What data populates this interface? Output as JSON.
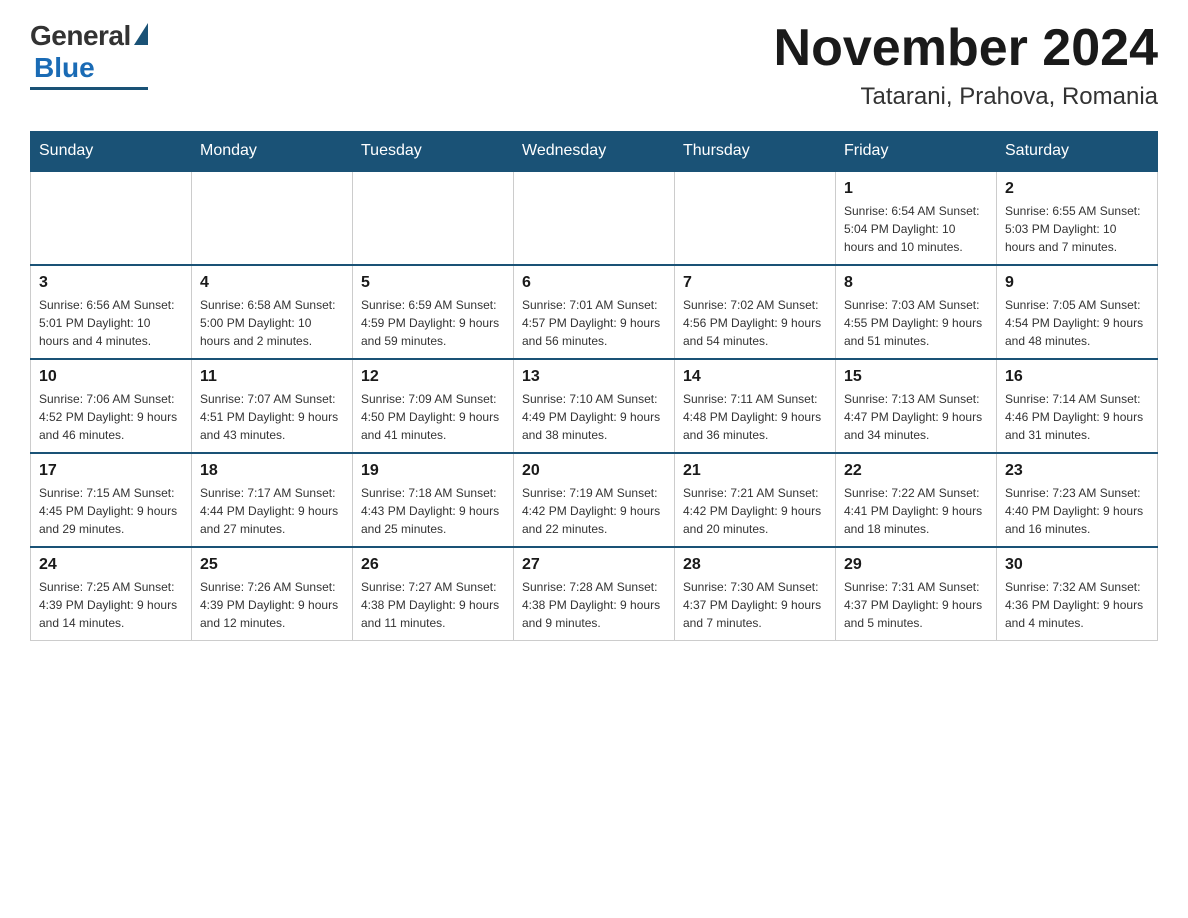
{
  "header": {
    "logo_general": "General",
    "logo_blue": "Blue",
    "month_title": "November 2024",
    "location": "Tatarani, Prahova, Romania"
  },
  "days_of_week": [
    "Sunday",
    "Monday",
    "Tuesday",
    "Wednesday",
    "Thursday",
    "Friday",
    "Saturday"
  ],
  "weeks": [
    [
      {
        "day": "",
        "info": ""
      },
      {
        "day": "",
        "info": ""
      },
      {
        "day": "",
        "info": ""
      },
      {
        "day": "",
        "info": ""
      },
      {
        "day": "",
        "info": ""
      },
      {
        "day": "1",
        "info": "Sunrise: 6:54 AM\nSunset: 5:04 PM\nDaylight: 10 hours\nand 10 minutes."
      },
      {
        "day": "2",
        "info": "Sunrise: 6:55 AM\nSunset: 5:03 PM\nDaylight: 10 hours\nand 7 minutes."
      }
    ],
    [
      {
        "day": "3",
        "info": "Sunrise: 6:56 AM\nSunset: 5:01 PM\nDaylight: 10 hours\nand 4 minutes."
      },
      {
        "day": "4",
        "info": "Sunrise: 6:58 AM\nSunset: 5:00 PM\nDaylight: 10 hours\nand 2 minutes."
      },
      {
        "day": "5",
        "info": "Sunrise: 6:59 AM\nSunset: 4:59 PM\nDaylight: 9 hours\nand 59 minutes."
      },
      {
        "day": "6",
        "info": "Sunrise: 7:01 AM\nSunset: 4:57 PM\nDaylight: 9 hours\nand 56 minutes."
      },
      {
        "day": "7",
        "info": "Sunrise: 7:02 AM\nSunset: 4:56 PM\nDaylight: 9 hours\nand 54 minutes."
      },
      {
        "day": "8",
        "info": "Sunrise: 7:03 AM\nSunset: 4:55 PM\nDaylight: 9 hours\nand 51 minutes."
      },
      {
        "day": "9",
        "info": "Sunrise: 7:05 AM\nSunset: 4:54 PM\nDaylight: 9 hours\nand 48 minutes."
      }
    ],
    [
      {
        "day": "10",
        "info": "Sunrise: 7:06 AM\nSunset: 4:52 PM\nDaylight: 9 hours\nand 46 minutes."
      },
      {
        "day": "11",
        "info": "Sunrise: 7:07 AM\nSunset: 4:51 PM\nDaylight: 9 hours\nand 43 minutes."
      },
      {
        "day": "12",
        "info": "Sunrise: 7:09 AM\nSunset: 4:50 PM\nDaylight: 9 hours\nand 41 minutes."
      },
      {
        "day": "13",
        "info": "Sunrise: 7:10 AM\nSunset: 4:49 PM\nDaylight: 9 hours\nand 38 minutes."
      },
      {
        "day": "14",
        "info": "Sunrise: 7:11 AM\nSunset: 4:48 PM\nDaylight: 9 hours\nand 36 minutes."
      },
      {
        "day": "15",
        "info": "Sunrise: 7:13 AM\nSunset: 4:47 PM\nDaylight: 9 hours\nand 34 minutes."
      },
      {
        "day": "16",
        "info": "Sunrise: 7:14 AM\nSunset: 4:46 PM\nDaylight: 9 hours\nand 31 minutes."
      }
    ],
    [
      {
        "day": "17",
        "info": "Sunrise: 7:15 AM\nSunset: 4:45 PM\nDaylight: 9 hours\nand 29 minutes."
      },
      {
        "day": "18",
        "info": "Sunrise: 7:17 AM\nSunset: 4:44 PM\nDaylight: 9 hours\nand 27 minutes."
      },
      {
        "day": "19",
        "info": "Sunrise: 7:18 AM\nSunset: 4:43 PM\nDaylight: 9 hours\nand 25 minutes."
      },
      {
        "day": "20",
        "info": "Sunrise: 7:19 AM\nSunset: 4:42 PM\nDaylight: 9 hours\nand 22 minutes."
      },
      {
        "day": "21",
        "info": "Sunrise: 7:21 AM\nSunset: 4:42 PM\nDaylight: 9 hours\nand 20 minutes."
      },
      {
        "day": "22",
        "info": "Sunrise: 7:22 AM\nSunset: 4:41 PM\nDaylight: 9 hours\nand 18 minutes."
      },
      {
        "day": "23",
        "info": "Sunrise: 7:23 AM\nSunset: 4:40 PM\nDaylight: 9 hours\nand 16 minutes."
      }
    ],
    [
      {
        "day": "24",
        "info": "Sunrise: 7:25 AM\nSunset: 4:39 PM\nDaylight: 9 hours\nand 14 minutes."
      },
      {
        "day": "25",
        "info": "Sunrise: 7:26 AM\nSunset: 4:39 PM\nDaylight: 9 hours\nand 12 minutes."
      },
      {
        "day": "26",
        "info": "Sunrise: 7:27 AM\nSunset: 4:38 PM\nDaylight: 9 hours\nand 11 minutes."
      },
      {
        "day": "27",
        "info": "Sunrise: 7:28 AM\nSunset: 4:38 PM\nDaylight: 9 hours\nand 9 minutes."
      },
      {
        "day": "28",
        "info": "Sunrise: 7:30 AM\nSunset: 4:37 PM\nDaylight: 9 hours\nand 7 minutes."
      },
      {
        "day": "29",
        "info": "Sunrise: 7:31 AM\nSunset: 4:37 PM\nDaylight: 9 hours\nand 5 minutes."
      },
      {
        "day": "30",
        "info": "Sunrise: 7:32 AM\nSunset: 4:36 PM\nDaylight: 9 hours\nand 4 minutes."
      }
    ]
  ]
}
